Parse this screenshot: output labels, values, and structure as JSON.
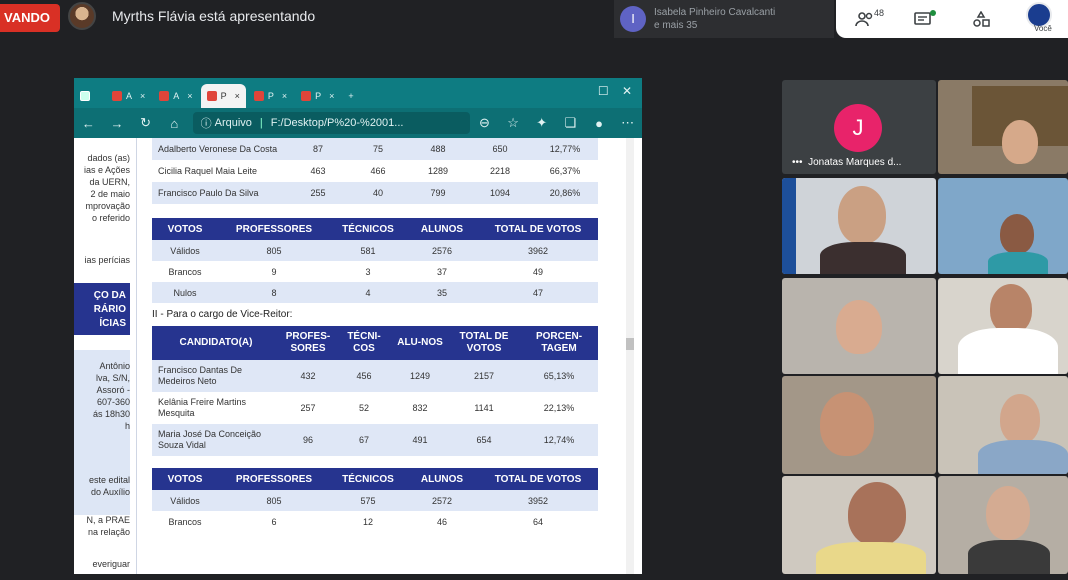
{
  "meet": {
    "recording_label": "VANDO",
    "presenter_text": "Myrths Flávia está apresentando",
    "participants_pill": {
      "name": "Isabela Pinheiro Cavalcanti",
      "more": "e mais 35",
      "avatar_letter": "I"
    },
    "controls": {
      "people_count": "48",
      "self_label": "Você"
    }
  },
  "browser": {
    "tabs": [
      {
        "label": "A",
        "icon": "pdf-icon"
      },
      {
        "label": "A",
        "icon": "pdf-icon"
      },
      {
        "label": "P",
        "icon": "pdf-icon",
        "active": true
      },
      {
        "label": "P",
        "icon": "pdf-icon"
      },
      {
        "label": "P",
        "icon": "pdf-icon"
      }
    ],
    "address_label": "Arquivo",
    "url": "F:/Desktop/P%20-%2001..."
  },
  "document": {
    "left_fragments": [
      "dados (as)",
      "ias e Ações",
      "da UERN,",
      "2 de maio",
      "mprovação",
      "o referido",
      "ias perícias",
      "ÇO DA",
      "RÁRIO",
      "ÍCIAS",
      "Antônio",
      "lva, S/N,",
      "Assoró -",
      "607-360",
      "ás 18h30",
      "h",
      "este edital",
      "do Auxílio",
      "N, a PRAE",
      "na relação",
      "everiguar"
    ],
    "table1_rows": [
      {
        "name": "Adalberto Veronese Da Costa",
        "c1": "87",
        "c2": "75",
        "c3": "488",
        "c4": "650",
        "c5": "12,77%"
      },
      {
        "name": "Cicilia Raquel Maia Leite",
        "c1": "463",
        "c2": "466",
        "c3": "1289",
        "c4": "2218",
        "c5": "66,37%"
      },
      {
        "name": "Francisco Paulo Da Silva",
        "c1": "255",
        "c2": "40",
        "c3": "799",
        "c4": "1094",
        "c5": "20,86%"
      }
    ],
    "votes_headers": [
      "VOTOS",
      "PROFESSORES",
      "TÉCNICOS",
      "ALUNOS",
      "TOTAL DE VOTOS"
    ],
    "votes1_rows": [
      {
        "label": "Válidos",
        "c1": "805",
        "c2": "581",
        "c3": "2576",
        "c4": "3962"
      },
      {
        "label": "Brancos",
        "c1": "9",
        "c2": "3",
        "c3": "37",
        "c4": "49"
      },
      {
        "label": "Nulos",
        "c1": "8",
        "c2": "4",
        "c3": "35",
        "c4": "47"
      }
    ],
    "cargo_title": "II - Para o cargo de Vice-Reitor:",
    "cand_headers": [
      "CANDIDATO(A)",
      "PROFES-SORES",
      "TÉCNI-COS",
      "ALU-NOS",
      "TOTAL DE VOTOS",
      "PORCEN-TAGEM"
    ],
    "cand_rows": [
      {
        "name": "Francisco Dantas De Medeiros Neto",
        "c1": "432",
        "c2": "456",
        "c3": "1249",
        "c4": "2157",
        "c5": "65,13%"
      },
      {
        "name": "Kelânia Freire Martins Mesquita",
        "c1": "257",
        "c2": "52",
        "c3": "832",
        "c4": "1141",
        "c5": "22,13%"
      },
      {
        "name": "Maria José Da Conceição Souza Vidal",
        "c1": "96",
        "c2": "67",
        "c3": "491",
        "c4": "654",
        "c5": "12,74%"
      }
    ],
    "votes2_rows": [
      {
        "label": "Válidos",
        "c1": "805",
        "c2": "575",
        "c3": "2572",
        "c4": "3952"
      },
      {
        "label": "Brancos",
        "c1": "6",
        "c2": "12",
        "c3": "46",
        "c4": "64"
      }
    ]
  },
  "participants": {
    "jonatas": {
      "letter": "J",
      "name": "Jonatas Marques d..."
    },
    "colors": {
      "accent_pink": "#e8236a",
      "table_header": "#26348f",
      "table_alt": "#dfe7f6",
      "browser_teal": "#0e7c82"
    }
  }
}
